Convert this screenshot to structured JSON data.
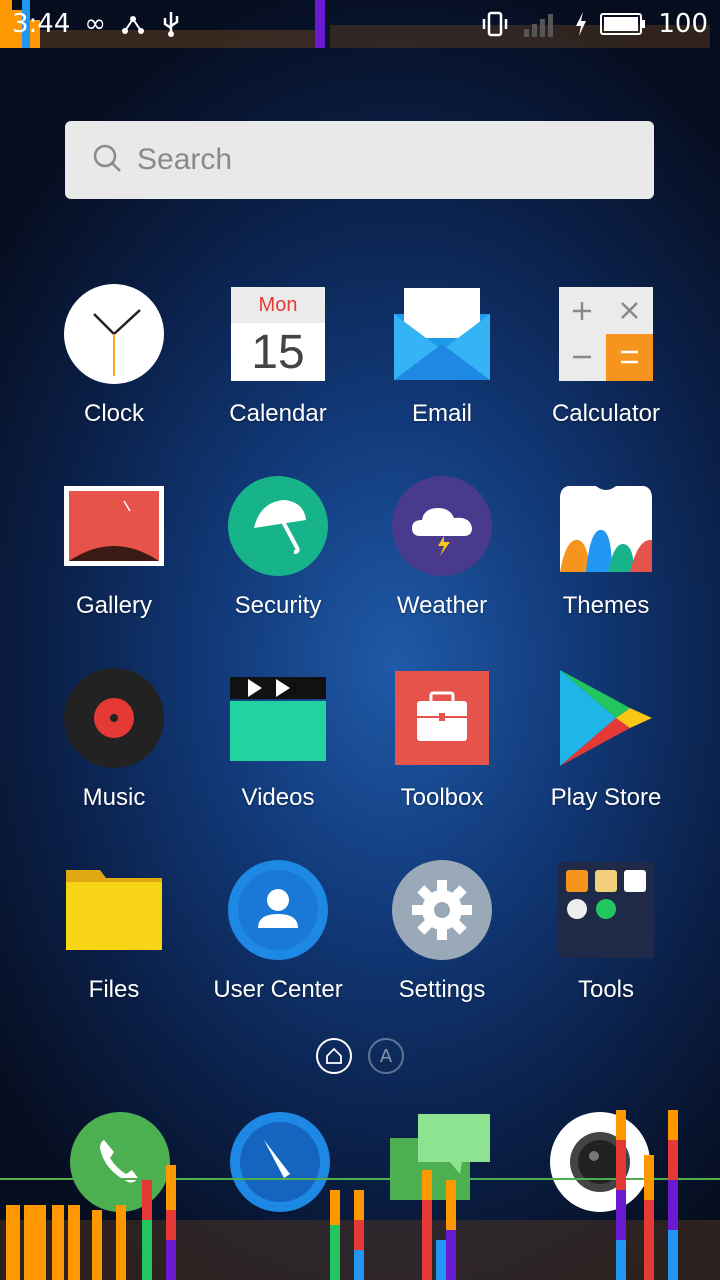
{
  "status_bar": {
    "time": "3:44",
    "battery": "100"
  },
  "search": {
    "placeholder": "Search"
  },
  "apps": [
    {
      "label": "Clock"
    },
    {
      "label": "Calendar",
      "day": "Mon",
      "date": "15"
    },
    {
      "label": "Email"
    },
    {
      "label": "Calculator"
    },
    {
      "label": "Gallery"
    },
    {
      "label": "Security"
    },
    {
      "label": "Weather"
    },
    {
      "label": "Themes"
    },
    {
      "label": "Music"
    },
    {
      "label": "Videos"
    },
    {
      "label": "Toolbox"
    },
    {
      "label": "Play Store"
    },
    {
      "label": "Files"
    },
    {
      "label": "User Center"
    },
    {
      "label": "Settings"
    },
    {
      "label": "Tools"
    }
  ],
  "pager": {
    "inactive_label": "A"
  },
  "dock": [
    {
      "name": "Phone"
    },
    {
      "name": "Browser"
    },
    {
      "name": "Messages"
    },
    {
      "name": "Camera"
    }
  ],
  "colors": {
    "security": "#17b38a",
    "weather": "#4a3a8e",
    "toolbox": "#e5534b",
    "files": "#f8c617",
    "user_center": "#1e88e5",
    "settings": "#9aa9b8",
    "phone": "#4caf50",
    "browser": "#1e88e5"
  }
}
